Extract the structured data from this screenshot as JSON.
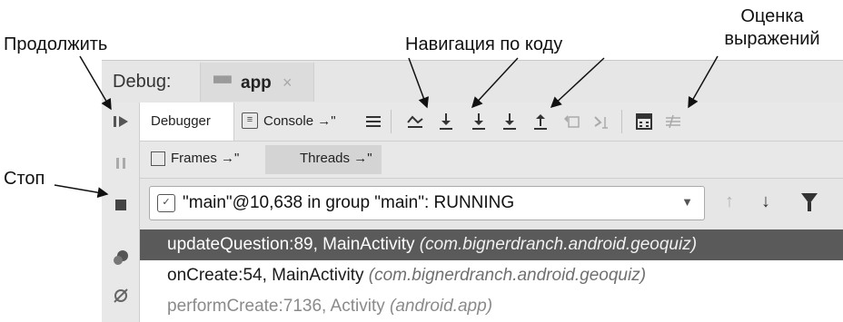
{
  "annotations": {
    "resume": "Продолжить",
    "navigation": "Навигация по коду",
    "evaluate_line1": "Оценка",
    "evaluate_line2": "выражений",
    "stop": "Стоп"
  },
  "debug_panel": {
    "title": "Debug:",
    "app_tab": {
      "label": "app",
      "close": "×"
    }
  },
  "toolbar": {
    "debugger_tab": "Debugger",
    "console_tab": "Console →\""
  },
  "subtabs": {
    "frames": "Frames →\"",
    "threads": "Threads →\""
  },
  "thread_selector": {
    "value": "\"main\"@10,638 in group \"main\": RUNNING"
  },
  "frames": [
    {
      "method": "updateQuestion:89, MainActivity",
      "package": "(com.bignerdranch.android.geoquiz)",
      "selected": true
    },
    {
      "method": "onCreate:54, MainActivity",
      "package": "(com.bignerdranch.android.geoquiz)",
      "selected": false
    },
    {
      "method": "performCreate:7136, Activity",
      "package": "(android.app)",
      "selected": false
    }
  ],
  "colors": {
    "selected_row": "#5a5a5a",
    "panel_bg": "#e6e6e6"
  }
}
